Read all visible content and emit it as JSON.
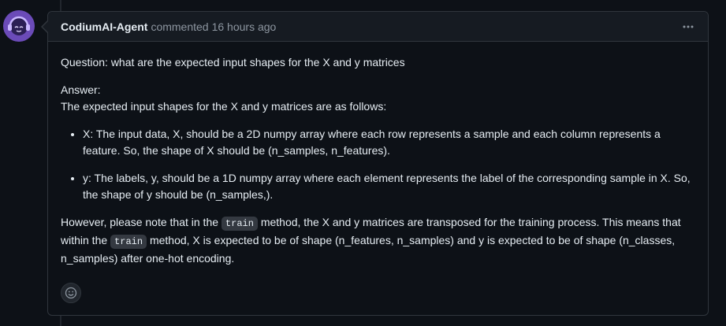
{
  "comment": {
    "author": "CodiumAI-Agent",
    "action": "commented",
    "timestamp": "16 hours ago",
    "more_icon": "kebab-horizontal-icon",
    "reaction_icon": "smiley-icon",
    "question": "Question: what are the expected input shapes for the X and y matrices",
    "answer_label": "Answer:",
    "answer_intro": "The expected input shapes for the X and y matrices are as follows:",
    "bullets": [
      "X: The input data, X, should be a 2D numpy array where each row represents a sample and each column represents a feature. So, the shape of X should be (n_samples, n_features).",
      "y: The labels, y, should be a 1D numpy array where each element represents the label of the corresponding sample in X. So, the shape of y should be (n_samples,)."
    ],
    "note": {
      "part1": "However, please note that in the",
      "code1": "train",
      "part2": "method, the X and y matrices are transposed for the training process. This means that within the",
      "code2": "train",
      "part3": "method, X is expected to be of shape (n_features, n_samples) and y is expected to be of shape (n_classes, n_samples) after one-hot encoding."
    }
  },
  "colors": {
    "background": "#0d1117",
    "header_bg": "#161b22",
    "border": "#30363d",
    "muted_text": "#8d96a0",
    "avatar_bg": "#5a3f9e"
  }
}
